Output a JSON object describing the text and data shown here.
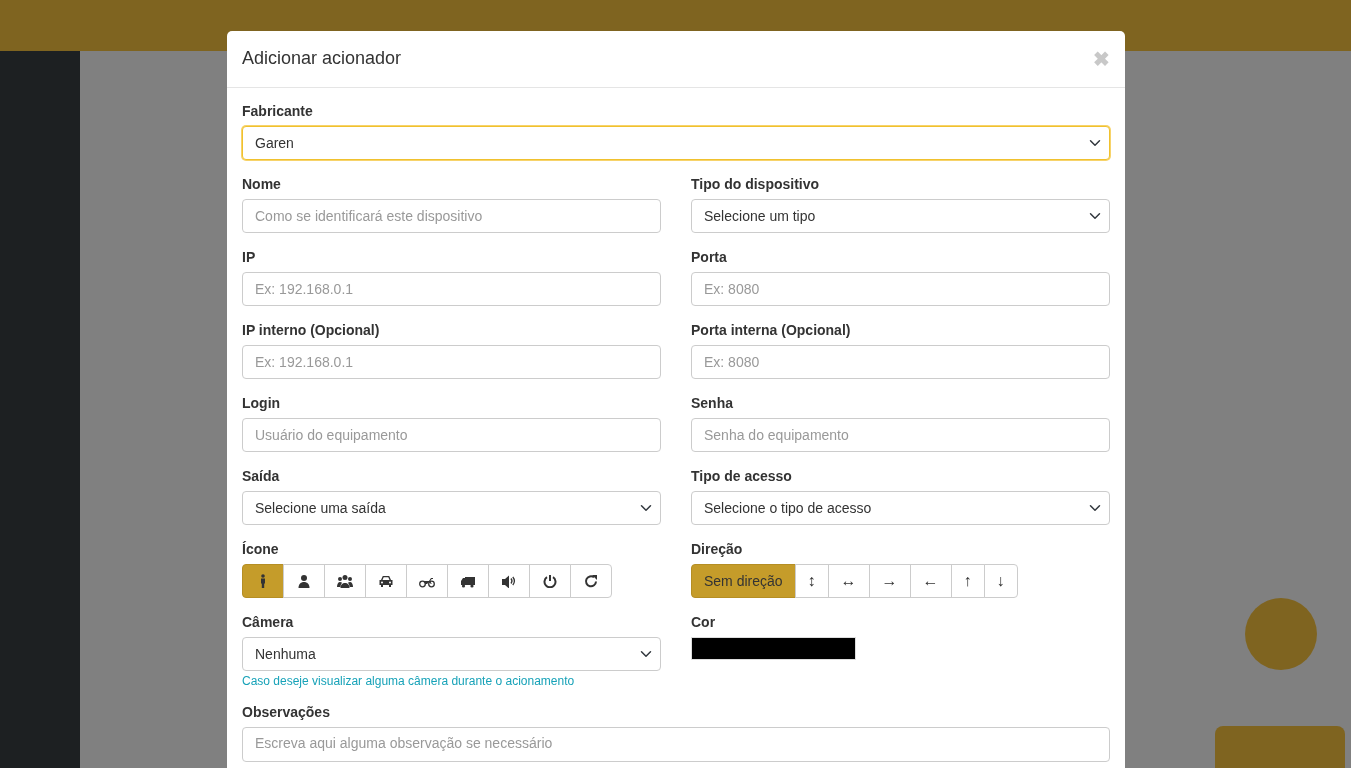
{
  "modal": {
    "title": "Adicionar acionador",
    "close": "✖"
  },
  "fabricante": {
    "label": "Fabricante",
    "value": "Garen",
    "focused": true
  },
  "rows": [
    [
      {
        "kind": "input",
        "label": "Nome",
        "placeholder": "Como se identificará este dispositivo"
      },
      {
        "kind": "select",
        "label": "Tipo do dispositivo",
        "value": "Selecione um tipo"
      }
    ],
    [
      {
        "kind": "input",
        "label": "IP",
        "placeholder": "Ex: 192.168.0.1"
      },
      {
        "kind": "input",
        "label": "Porta",
        "placeholder": "Ex: 8080"
      }
    ],
    [
      {
        "kind": "input",
        "label": "IP interno (Opcional)",
        "placeholder": "Ex: 192.168.0.1"
      },
      {
        "kind": "input",
        "label": "Porta interna (Opcional)",
        "placeholder": "Ex: 8080"
      }
    ],
    [
      {
        "kind": "input",
        "label": "Login",
        "placeholder": "Usuário do equipamento"
      },
      {
        "kind": "input",
        "label": "Senha",
        "placeholder": "Senha do equipamento"
      }
    ],
    [
      {
        "kind": "select",
        "label": "Saída",
        "value": "Selecione uma saída"
      },
      {
        "kind": "select",
        "label": "Tipo de acesso",
        "value": "Selecione o tipo de acesso"
      }
    ]
  ],
  "icone": {
    "label": "Ícone",
    "options": [
      {
        "kind": "person",
        "selected": true
      },
      {
        "kind": "user",
        "selected": false
      },
      {
        "kind": "users",
        "selected": false
      },
      {
        "kind": "car",
        "selected": false
      },
      {
        "kind": "motorcycle",
        "selected": false
      },
      {
        "kind": "truck",
        "selected": false
      },
      {
        "kind": "volume",
        "selected": false
      },
      {
        "kind": "power",
        "selected": false
      },
      {
        "kind": "refresh",
        "selected": false
      }
    ]
  },
  "direcao": {
    "label": "Direção",
    "options": [
      {
        "text": "Sem direção",
        "selected": true
      },
      {
        "text": "↕",
        "selected": false
      },
      {
        "text": "↔",
        "selected": false
      },
      {
        "text": "→",
        "selected": false
      },
      {
        "text": "←",
        "selected": false
      },
      {
        "text": "↑",
        "selected": false
      },
      {
        "text": "↓",
        "selected": false
      }
    ]
  },
  "camera": {
    "label": "Câmera",
    "value": "Nenhuma",
    "help": "Caso deseje visualizar alguma câmera durante o acionamento"
  },
  "cor": {
    "label": "Cor",
    "color": "#000000"
  },
  "observacoes": {
    "label": "Observações",
    "placeholder": "Escreva aqui alguma observação se necessário"
  }
}
